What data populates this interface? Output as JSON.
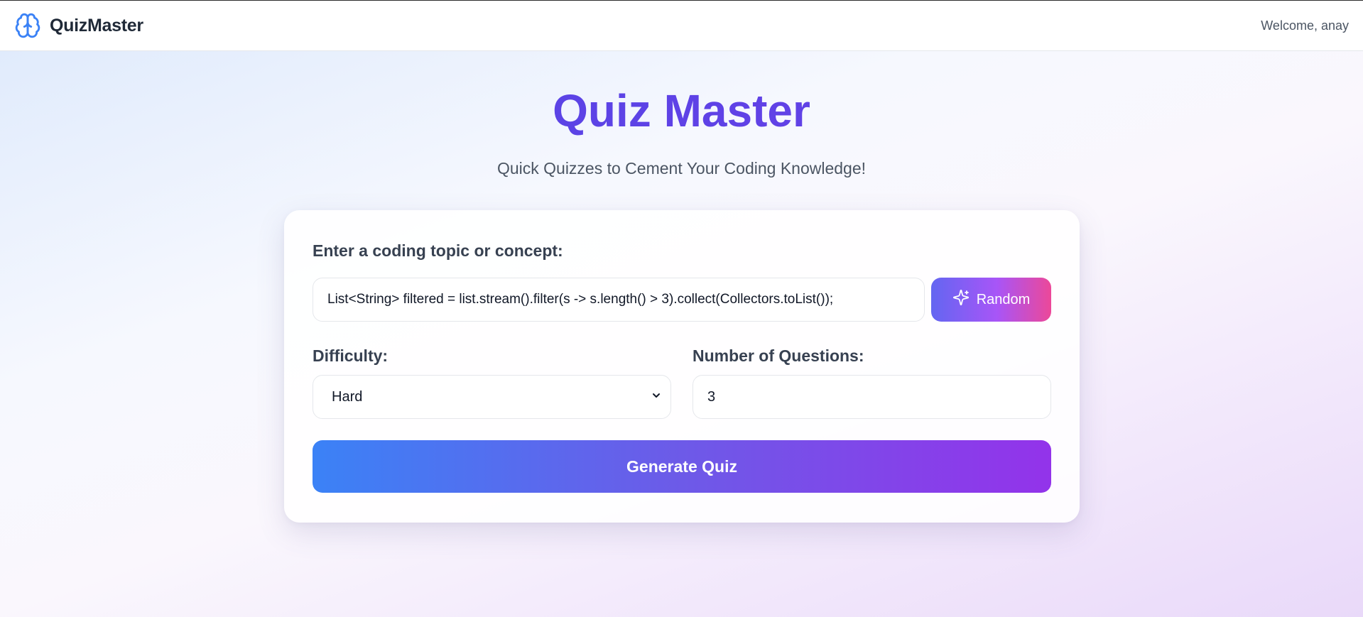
{
  "header": {
    "brand_name": "QuizMaster",
    "brand_icon": "brain-icon",
    "welcome_text": "Welcome, anay"
  },
  "hero": {
    "title": "Quiz Master",
    "subtitle": "Quick Quizzes to Cement Your Coding Knowledge!"
  },
  "form": {
    "topic_label": "Enter a coding topic or concept:",
    "topic_value": "List<String> filtered = list.stream().filter(s -> s.length() > 3).collect(Collectors.toList());",
    "random_label": "Random",
    "random_icon": "sparkles-icon",
    "difficulty_label": "Difficulty:",
    "difficulty_value": "Hard",
    "count_label": "Number of Questions:",
    "count_value": "3",
    "generate_label": "Generate Quiz"
  },
  "colors": {
    "accent": "#4f46e5",
    "generate_gradient": [
      "#3b82f6",
      "#9333ea"
    ],
    "random_gradient": [
      "#6366f1",
      "#a855f7",
      "#ec4899"
    ]
  }
}
